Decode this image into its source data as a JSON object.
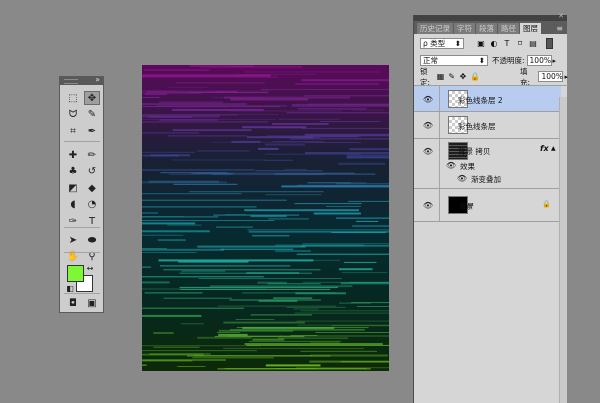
{
  "tools_panel": {
    "collapse_symbol": "»",
    "tools": [
      {
        "name": "marquee-tool-icon",
        "glyph": "⬚"
      },
      {
        "name": "move-tool-icon",
        "glyph": "✥"
      },
      {
        "name": "lasso-tool-icon",
        "glyph": "ᗢ"
      },
      {
        "name": "quick-select-tool-icon",
        "glyph": "✎"
      },
      {
        "name": "crop-tool-icon",
        "glyph": "⌗"
      },
      {
        "name": "eyedropper-tool-icon",
        "glyph": "✒"
      },
      {
        "name": "healing-brush-tool-icon",
        "glyph": "✚"
      },
      {
        "name": "brush-tool-icon",
        "glyph": "✏"
      },
      {
        "name": "clone-stamp-tool-icon",
        "glyph": "♣"
      },
      {
        "name": "history-brush-tool-icon",
        "glyph": "↺"
      },
      {
        "name": "eraser-tool-icon",
        "glyph": "◩"
      },
      {
        "name": "paint-bucket-tool-icon",
        "glyph": "◆"
      },
      {
        "name": "blur-tool-icon",
        "glyph": "◖"
      },
      {
        "name": "dodge-tool-icon",
        "glyph": "◔"
      },
      {
        "name": "pen-tool-icon",
        "glyph": "✑"
      },
      {
        "name": "type-tool-icon",
        "glyph": "T"
      },
      {
        "name": "path-select-tool-icon",
        "glyph": "➤"
      },
      {
        "name": "shape-tool-icon",
        "glyph": "⬬"
      },
      {
        "name": "hand-tool-icon",
        "glyph": "✋"
      },
      {
        "name": "zoom-tool-icon",
        "glyph": "⚲"
      }
    ],
    "foreground_color": "#7ef734",
    "background_color": "#ffffff",
    "quick_mask_glyph": "◘",
    "screen_mode_glyph": "▣"
  },
  "layers_panel": {
    "tabs": [
      "历史记录",
      "字符",
      "段落",
      "路径",
      "图层"
    ],
    "active_tab": 4,
    "menu_glyph": "≡",
    "close_glyph": "✕",
    "filter": {
      "label": "ρ 类型",
      "icons": [
        "image-filter-icon",
        "adjustment-filter-icon",
        "type-filter-icon",
        "shape-filter-icon",
        "smart-object-filter-icon"
      ],
      "glyphs": [
        "▣",
        "◐",
        "T",
        "⌑",
        "▤"
      ]
    },
    "blend_mode": "正常",
    "opacity_label": "不透明度:",
    "opacity_value": "100%",
    "lock_label": "锁定:",
    "lock_glyphs": [
      "▦",
      "✎",
      "✥",
      "🔒"
    ],
    "fill_label": "填充:",
    "fill_value": "100%",
    "layers": [
      {
        "name": "彩色线条层 2",
        "thumb": "trans",
        "selected": true
      },
      {
        "name": "彩色线条层",
        "thumb": "trans",
        "selected": false
      },
      {
        "name": "背景 拷贝",
        "thumb": "stripes",
        "selected": false,
        "fx": "fx",
        "effects_label": "效果",
        "effect": "渐变叠加"
      },
      {
        "name": "背景",
        "thumb": "black",
        "selected": false,
        "locked": true
      }
    ]
  }
}
